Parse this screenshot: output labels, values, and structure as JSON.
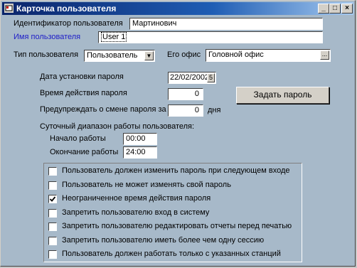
{
  "window": {
    "title": "Карточка пользователя",
    "controls": {
      "minimize": "_",
      "maximize": "□",
      "close": "×"
    }
  },
  "user": {
    "id_label": "Идентификатор пользователя",
    "id_value": "Мартинович",
    "name_label": "Имя пользователя",
    "name_value": "User 1",
    "type_label": "Тип пользователя",
    "type_value": "Пользователь",
    "office_label": "Его офис",
    "office_value": "Головной офис",
    "office_button": "..."
  },
  "password": {
    "set_date_label": "Дата установки пароля",
    "set_date_value": "22/02/2002",
    "validity_label": "Время действия пароля",
    "validity_value": "0",
    "warn_label": "Предупреждать о смене пароля за",
    "warn_value": "0",
    "warn_unit": "дня",
    "set_button": "Задать пароль"
  },
  "work_range": {
    "title": "Суточный диапазон работы пользователя:",
    "start_label": "Начало работы",
    "start_value": "00:00",
    "end_label": "Окончание работы",
    "end_value": "24:00"
  },
  "options": [
    {
      "label": "Пользователь должен изменить пароль при следующем входе",
      "checked": false
    },
    {
      "label": "Пользователь не может изменять свой пароль",
      "checked": false
    },
    {
      "label": "Неограниченное время действия пароля",
      "checked": true
    },
    {
      "label": "Запретить пользователю вход в систему",
      "checked": false
    },
    {
      "label": "Запретить пользователю редактировать отчеты перед печатью",
      "checked": false
    },
    {
      "label": "Запретить пользователю иметь более чем одну сессию",
      "checked": false
    },
    {
      "label": "Пользователь должен работать только с указанных станций",
      "checked": false
    }
  ],
  "colors": {
    "background": "#a7b9c9",
    "titlebar_start": "#0a246a",
    "titlebar_end": "#a6caf0",
    "highlight_label": "#2020c8"
  }
}
